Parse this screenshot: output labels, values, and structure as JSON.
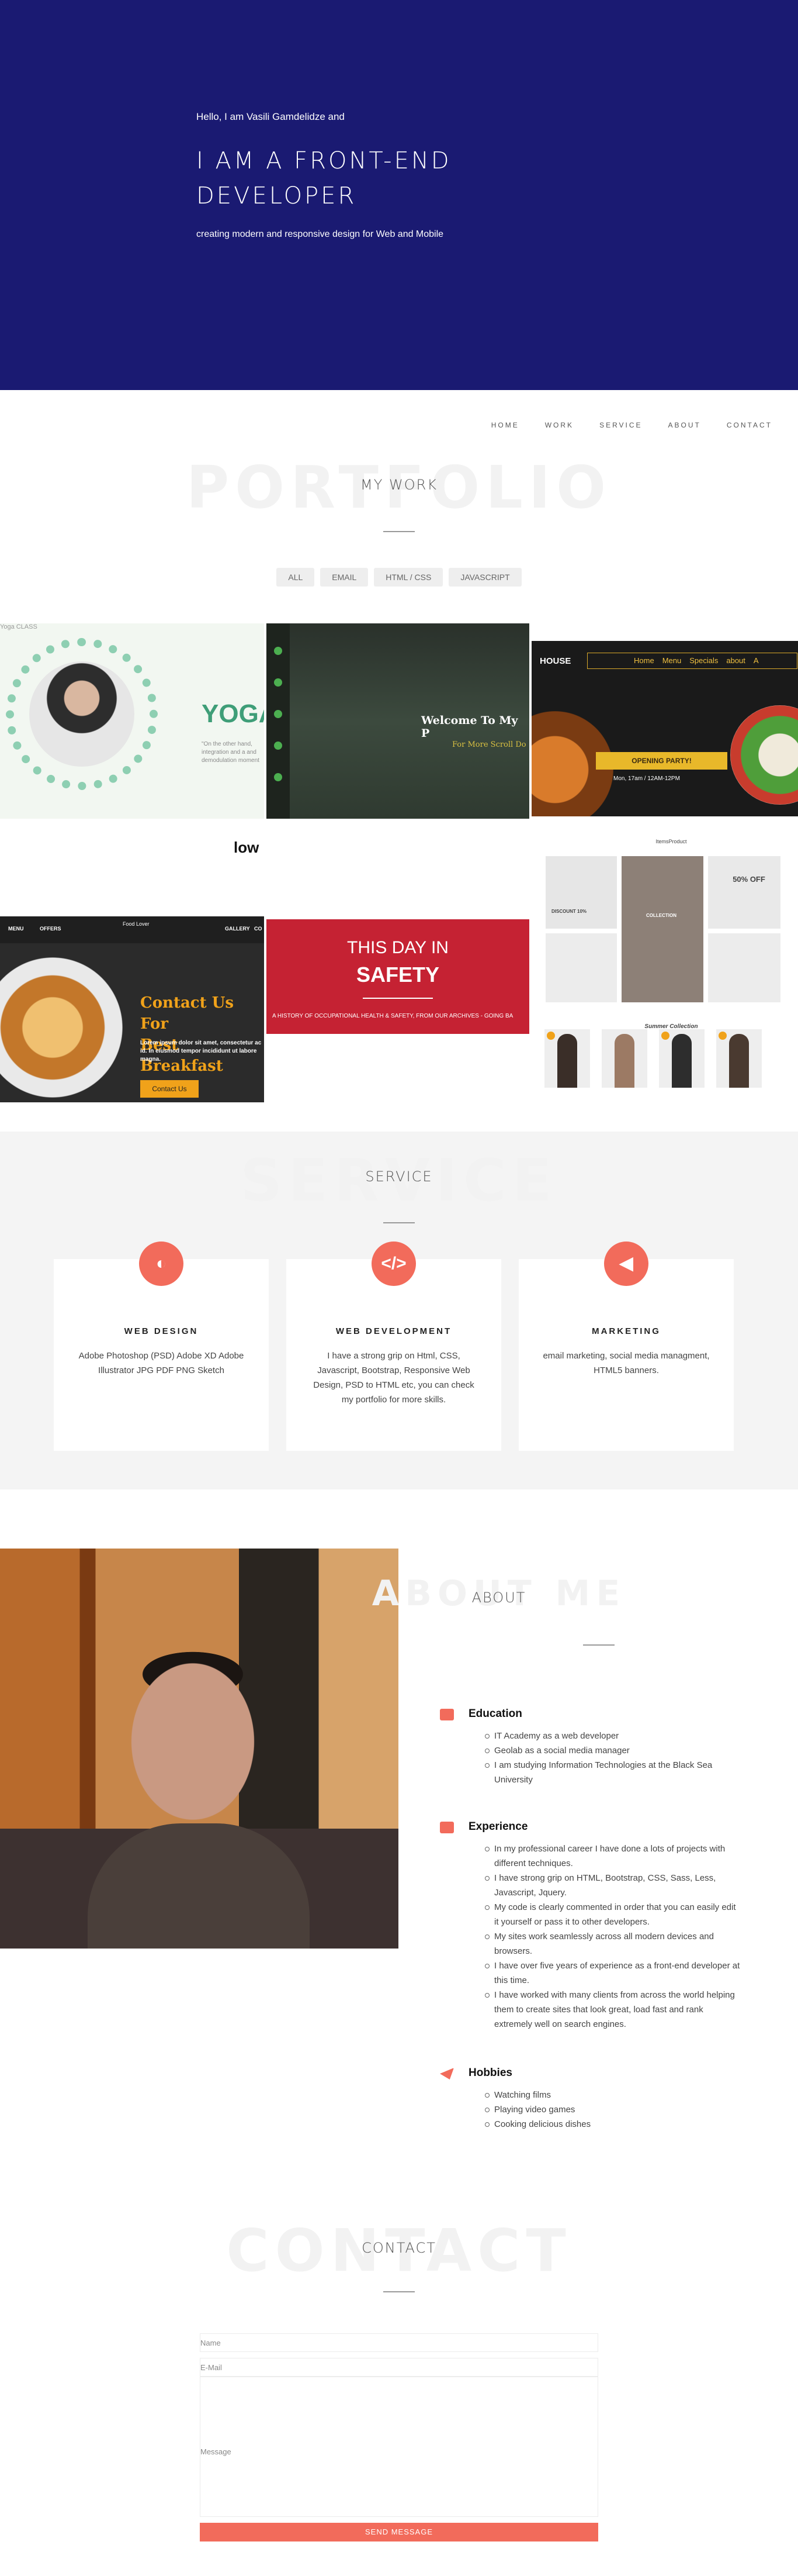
{
  "hero": {
    "intro": "Hello, I am Vasili Gamdelidze and",
    "title": "I AM A FRONT-END DEVELOPER",
    "subtitle": "creating modern and responsive design for Web and Mobile"
  },
  "nav": [
    "HOME",
    "WORK",
    "SERVICE",
    "ABOUT",
    "CONTACT"
  ],
  "portfolio": {
    "bg_title": "PORTFOLIO",
    "title": "MY WORK",
    "filters": [
      "ALL",
      "EMAIL",
      "HTML / CSS",
      "JAVASCRIPT"
    ],
    "tiles": {
      "yoga": {
        "logo": "Yoga CLASS",
        "word": "YOGA",
        "small": "\"On the other hand, integration and a and demodulation moment"
      },
      "forest": {
        "heading": "Welcome To My P",
        "sub": "For More Scroll Do"
      },
      "house": {
        "brand": "HOUSE",
        "menu": [
          "Home",
          "Menu",
          "Specials",
          "about",
          "A"
        ],
        "party": "OPENING PARTY!",
        "time": "Mon, 17am / 12AM-12PM"
      },
      "news": {
        "word": "low"
      },
      "food": {
        "nav": [
          "MENU",
          "OFFERS",
          "GALLERY",
          "CO"
        ],
        "logo": "Food Lover",
        "heading_1": "Contact Us For",
        "heading_2": "Best Breakfast",
        "text": "Lorem ipsum dolor sit amet, consectetur ac id. In eiusmod tempor incididunt ut labore magna.",
        "button": "Contact Us"
      },
      "safety": {
        "line1": "THIS DAY IN",
        "line2": "SAFETY",
        "line3": "A HISTORY OF OCCUPATIONAL HEALTH & SAFETY, FROM OUR ARCHIVES - GOING BA"
      },
      "shop": {
        "nav": "ItemsProduct",
        "discount": "50% OFF",
        "collection": "COLLECTION",
        "discount_label": "DISCOUNT 10%",
        "summer": "Summer Collection"
      }
    }
  },
  "service": {
    "bg_title": "SERVICE",
    "title": "SERVICE",
    "cards": [
      {
        "icon": "palette-icon",
        "title": "WEB DESIGN",
        "body": "Adobe Photoshop (PSD) Adobe XD Adobe Illustrator JPG PDF PNG Sketch"
      },
      {
        "icon": "code-icon",
        "title": "WEB DEVELOPMENT",
        "body": "I have a strong grip on Html, CSS, Javascript, Bootstrap, Responsive Web Design, PSD to HTML etc, you can check my portfolio for more skills."
      },
      {
        "icon": "megaphone-icon",
        "title": "MARKETING",
        "body": "email marketing, social media managment, HTML5 banners."
      }
    ]
  },
  "about": {
    "bg_title": "ABOUT ME",
    "title": "ABOUT",
    "education": {
      "title": "Education",
      "items": [
        "IT Academy as a web developer",
        "Geolab as a social media manager",
        "I am studying Information Technologies at the Black Sea University"
      ]
    },
    "experience": {
      "title": "Experience",
      "items": [
        "In my professional career I have done a lots of projects with different techniques.",
        "I have strong grip on HTML, Bootstrap, CSS, Sass, Less, Javascript, Jquery.",
        "My code is clearly commented in order that you can easily edit it yourself or pass it to other developers.",
        "My sites work seamlessly across all modern devices and browsers.",
        "I have over five years of experience as a front-end developer at this time.",
        "I have worked with many clients from across the world helping them to create sites that look great, load fast and rank extremely well on search engines."
      ]
    },
    "hobbies": {
      "title": "Hobbies",
      "items": [
        "Watching films",
        "Playing video games",
        "Cooking delicious dishes"
      ]
    }
  },
  "contact": {
    "bg_title": "CONTACT",
    "title": "CONTACT",
    "name_label": "Name",
    "email_label": "E-Mail",
    "message_label": "Message",
    "submit": "SEND MESSAGE"
  },
  "colors": {
    "hero_bg": "#1a1a72",
    "accent": "#f26b5b",
    "service_bg": "#f4f4f4"
  }
}
